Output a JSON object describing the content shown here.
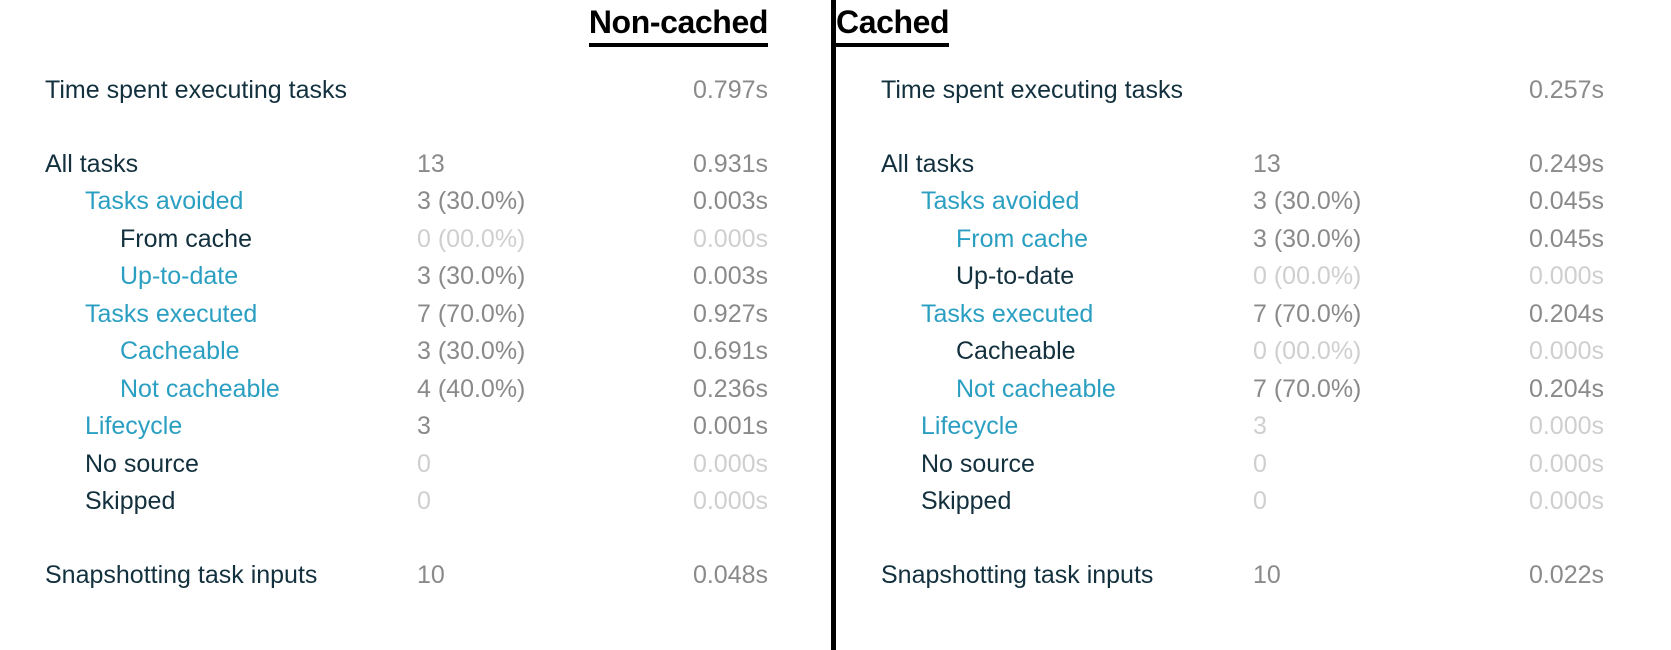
{
  "colors": {
    "label_dark": "#12303d",
    "label_teal": "#2b9fc2",
    "label_muted": "#cfcfcf",
    "value_gray": "#8a8a8a",
    "value_faint": "#cfcfcf",
    "divider": "#000000",
    "background": "#ffffff"
  },
  "panels": [
    {
      "title": "Non-cached",
      "rows": [
        {
          "label": "Time spent executing tasks",
          "indent": 0,
          "label_tone": "dark",
          "count": "",
          "count_tone": "gray",
          "time": "0.797s",
          "time_tone": "gray",
          "gap_after": true
        },
        {
          "label": "All tasks",
          "indent": 0,
          "label_tone": "dark",
          "count": "13",
          "count_tone": "gray",
          "time": "0.931s",
          "time_tone": "gray",
          "gap_after": false
        },
        {
          "label": "Tasks avoided",
          "indent": 1,
          "label_tone": "teal",
          "count": "3 (30.0%)",
          "count_tone": "gray",
          "time": "0.003s",
          "time_tone": "gray",
          "gap_after": false
        },
        {
          "label": "From cache",
          "indent": 2,
          "label_tone": "dark",
          "count": "0 (00.0%)",
          "count_tone": "faint",
          "time": "0.000s",
          "time_tone": "faint",
          "gap_after": false
        },
        {
          "label": "Up-to-date",
          "indent": 2,
          "label_tone": "teal",
          "count": "3 (30.0%)",
          "count_tone": "gray",
          "time": "0.003s",
          "time_tone": "gray",
          "gap_after": false
        },
        {
          "label": "Tasks executed",
          "indent": 1,
          "label_tone": "teal",
          "count": "7 (70.0%)",
          "count_tone": "gray",
          "time": "0.927s",
          "time_tone": "gray",
          "gap_after": false
        },
        {
          "label": "Cacheable",
          "indent": 2,
          "label_tone": "teal",
          "count": "3 (30.0%)",
          "count_tone": "gray",
          "time": "0.691s",
          "time_tone": "gray",
          "gap_after": false
        },
        {
          "label": "Not cacheable",
          "indent": 2,
          "label_tone": "teal",
          "count": "4 (40.0%)",
          "count_tone": "gray",
          "time": "0.236s",
          "time_tone": "gray",
          "gap_after": false
        },
        {
          "label": "Lifecycle",
          "indent": 1,
          "label_tone": "teal",
          "count": "3",
          "count_tone": "gray",
          "time": "0.001s",
          "time_tone": "gray",
          "gap_after": false
        },
        {
          "label": "No source",
          "indent": 1,
          "label_tone": "dark",
          "count": "0",
          "count_tone": "faint",
          "time": "0.000s",
          "time_tone": "faint",
          "gap_after": false
        },
        {
          "label": "Skipped",
          "indent": 1,
          "label_tone": "dark",
          "count": "0",
          "count_tone": "faint",
          "time": "0.000s",
          "time_tone": "faint",
          "gap_after": true
        },
        {
          "label": "Snapshotting task inputs",
          "indent": 0,
          "label_tone": "dark",
          "count": "10",
          "count_tone": "gray",
          "time": "0.048s",
          "time_tone": "gray",
          "gap_after": false
        }
      ]
    },
    {
      "title": "Cached",
      "rows": [
        {
          "label": "Time spent executing tasks",
          "indent": 0,
          "label_tone": "dark",
          "count": "",
          "count_tone": "gray",
          "time": "0.257s",
          "time_tone": "gray",
          "gap_after": true
        },
        {
          "label": "All tasks",
          "indent": 0,
          "label_tone": "dark",
          "count": "13",
          "count_tone": "gray",
          "time": "0.249s",
          "time_tone": "gray",
          "gap_after": false
        },
        {
          "label": "Tasks avoided",
          "indent": 1,
          "label_tone": "teal",
          "count": "3 (30.0%)",
          "count_tone": "gray",
          "time": "0.045s",
          "time_tone": "gray",
          "gap_after": false
        },
        {
          "label": "From cache",
          "indent": 2,
          "label_tone": "teal",
          "count": "3 (30.0%)",
          "count_tone": "gray",
          "time": "0.045s",
          "time_tone": "gray",
          "gap_after": false
        },
        {
          "label": "Up-to-date",
          "indent": 2,
          "label_tone": "dark",
          "count": "0 (00.0%)",
          "count_tone": "faint",
          "time": "0.000s",
          "time_tone": "faint",
          "gap_after": false
        },
        {
          "label": "Tasks executed",
          "indent": 1,
          "label_tone": "teal",
          "count": "7 (70.0%)",
          "count_tone": "gray",
          "time": "0.204s",
          "time_tone": "gray",
          "gap_after": false
        },
        {
          "label": "Cacheable",
          "indent": 2,
          "label_tone": "dark",
          "count": "0 (00.0%)",
          "count_tone": "faint",
          "time": "0.000s",
          "time_tone": "faint",
          "gap_after": false
        },
        {
          "label": "Not cacheable",
          "indent": 2,
          "label_tone": "teal",
          "count": "7 (70.0%)",
          "count_tone": "gray",
          "time": "0.204s",
          "time_tone": "gray",
          "gap_after": false
        },
        {
          "label": "Lifecycle",
          "indent": 1,
          "label_tone": "teal",
          "count": "3",
          "count_tone": "faint",
          "time": "0.000s",
          "time_tone": "faint",
          "gap_after": false
        },
        {
          "label": "No source",
          "indent": 1,
          "label_tone": "dark",
          "count": "0",
          "count_tone": "faint",
          "time": "0.000s",
          "time_tone": "faint",
          "gap_after": false
        },
        {
          "label": "Skipped",
          "indent": 1,
          "label_tone": "dark",
          "count": "0",
          "count_tone": "faint",
          "time": "0.000s",
          "time_tone": "faint",
          "gap_after": true
        },
        {
          "label": "Snapshotting task inputs",
          "indent": 0,
          "label_tone": "dark",
          "count": "10",
          "count_tone": "gray",
          "time": "0.022s",
          "time_tone": "gray",
          "gap_after": false
        }
      ]
    }
  ]
}
